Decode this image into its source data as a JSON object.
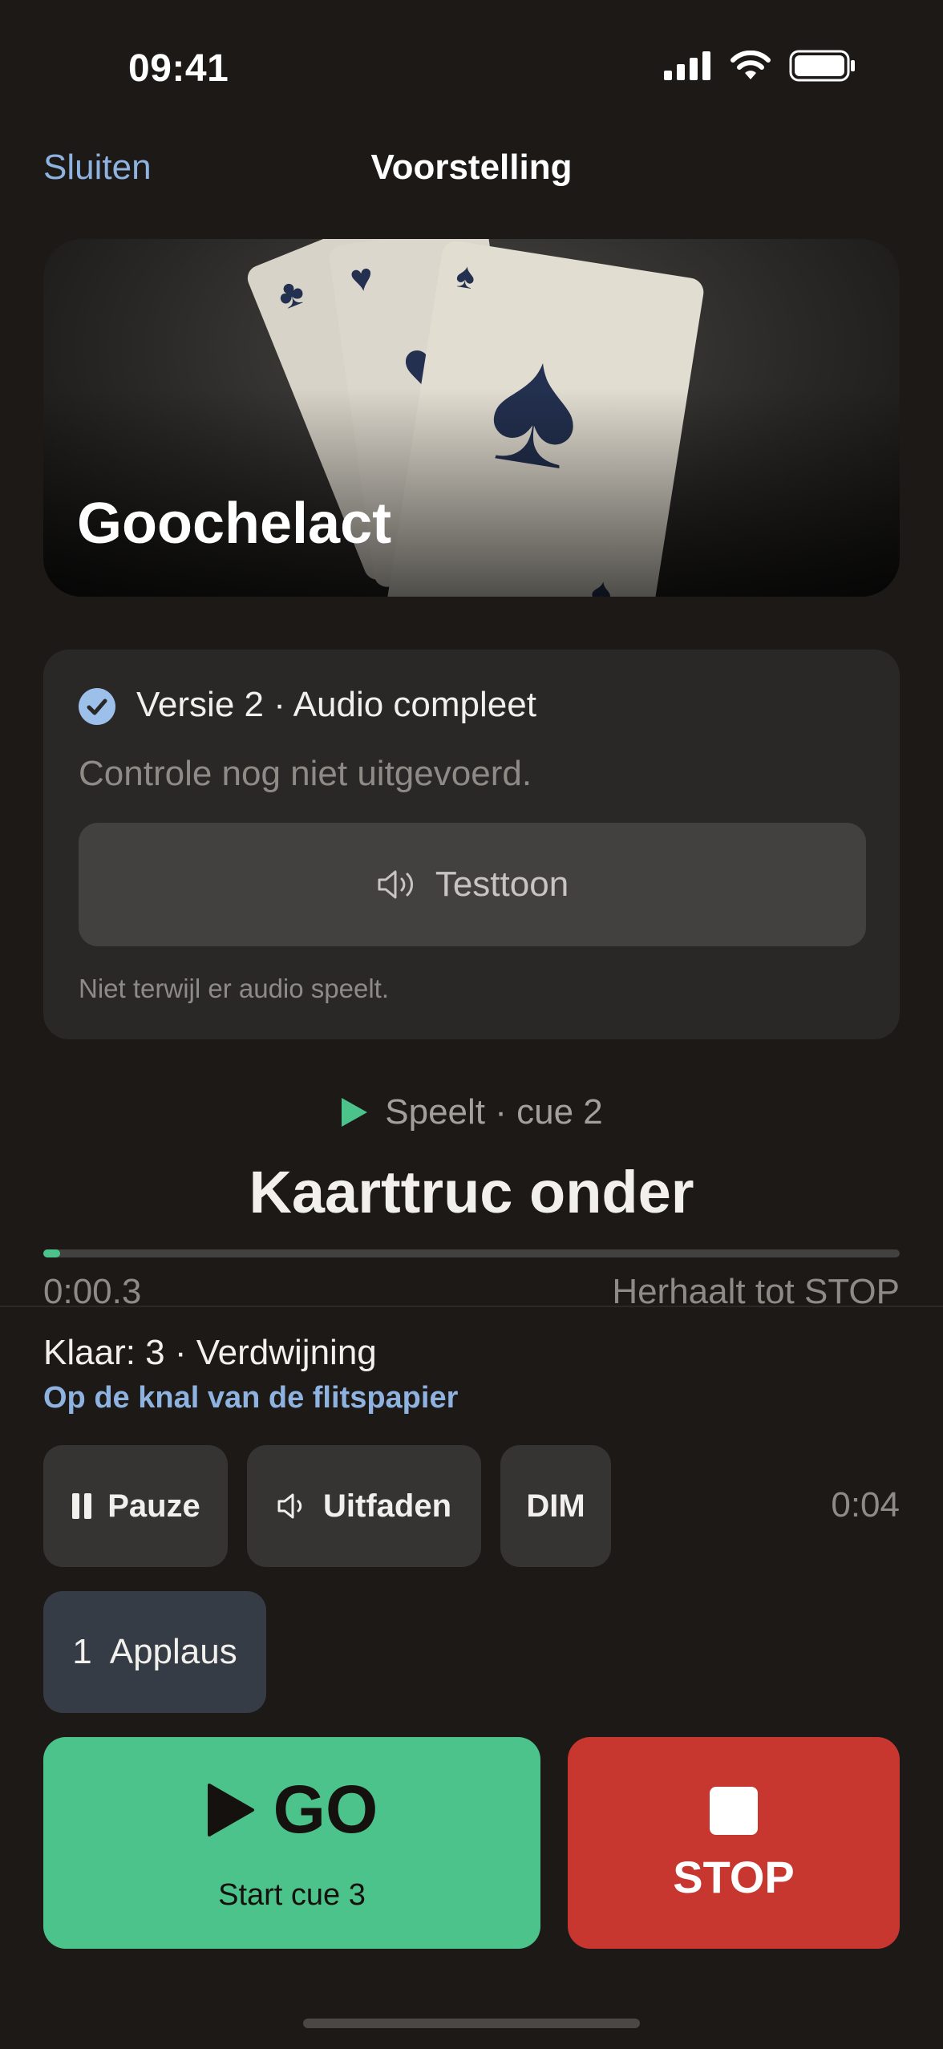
{
  "status_bar": {
    "time": "09:41",
    "icons": [
      "signal-icon",
      "wifi-icon",
      "battery-icon"
    ]
  },
  "nav": {
    "close_label": "Sluiten",
    "title": "Voorstelling"
  },
  "hero": {
    "title": "Goochelact"
  },
  "version_card": {
    "status_icon": "check-circle-icon",
    "status": "Versie 2 · Audio compleet",
    "check_note": "Controle nog niet uitgevoerd.",
    "test_button_label": "Testtoon",
    "test_button_icon": "speaker-icon",
    "footnote": "Niet terwijl er audio speelt."
  },
  "now_playing": {
    "state_icon": "play-icon",
    "state": "Speelt · cue 2",
    "title": "Kaarttruc onder",
    "elapsed": "0:00.3",
    "progress": 0.02,
    "repeat_note": "Herhaalt tot STOP"
  },
  "next_cue": {
    "label": "Klaar: 3 · Verdwijning",
    "note": "Op de knal van de flitspapier"
  },
  "controls": {
    "pause_label": "Pauze",
    "fade_label": "Uitfaden",
    "dim_label": "DIM",
    "timer": "0:04"
  },
  "quick_cue": {
    "number": "1",
    "label": "Applaus"
  },
  "go_button": {
    "label": "GO",
    "sub": "Start cue 3"
  },
  "stop_button": {
    "label": "STOP"
  },
  "colors": {
    "accent": "#8fb3e0",
    "go": "#4cc38a",
    "stop": "#c8372f",
    "background": "#1c1917"
  }
}
